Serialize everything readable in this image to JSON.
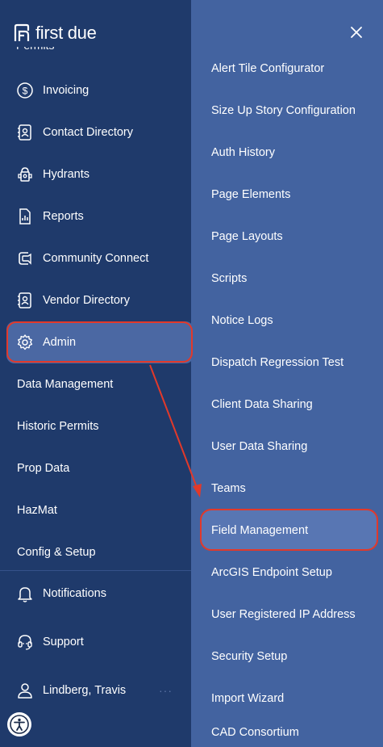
{
  "brand": {
    "name": "first due"
  },
  "left_nav": {
    "partial_item": "Permits",
    "items": [
      {
        "label": "Invoicing",
        "icon": "dollar-circle-icon"
      },
      {
        "label": "Contact Directory",
        "icon": "contact-card-icon"
      },
      {
        "label": "Hydrants",
        "icon": "hydrant-icon"
      },
      {
        "label": "Reports",
        "icon": "report-document-icon"
      },
      {
        "label": "Community Connect",
        "icon": "community-connect-icon"
      },
      {
        "label": "Vendor Directory",
        "icon": "vendor-card-icon"
      },
      {
        "label": "Admin",
        "icon": "gear-icon",
        "selected": true
      }
    ],
    "sub_items": [
      "Data Management",
      "Historic Permits",
      "Prop Data",
      "HazMat",
      "Config & Setup"
    ],
    "bottom": [
      {
        "label": "Notifications",
        "icon": "bell-icon"
      },
      {
        "label": "Support",
        "icon": "headset-icon"
      },
      {
        "label": "Lindberg, Travis",
        "icon": "user-icon"
      }
    ],
    "more_dots": "···"
  },
  "admin_panel": {
    "items": [
      "Alert Tile Configurator",
      "Size Up Story Configuration",
      "Auth History",
      "Page Elements",
      "Page Layouts",
      "Scripts",
      "Notice Logs",
      "Dispatch Regression Test",
      "Client Data Sharing",
      "User Data Sharing",
      "Teams",
      "Field Management",
      "ArcGIS Endpoint Setup",
      "User Registered IP Address",
      "Security Setup",
      "Import Wizard",
      "CAD Consortium"
    ],
    "highlighted": "Field Management"
  },
  "colors": {
    "left_bg": "#1f3a6b",
    "right_bg": "#4363a0",
    "highlight": "#e2392a"
  }
}
